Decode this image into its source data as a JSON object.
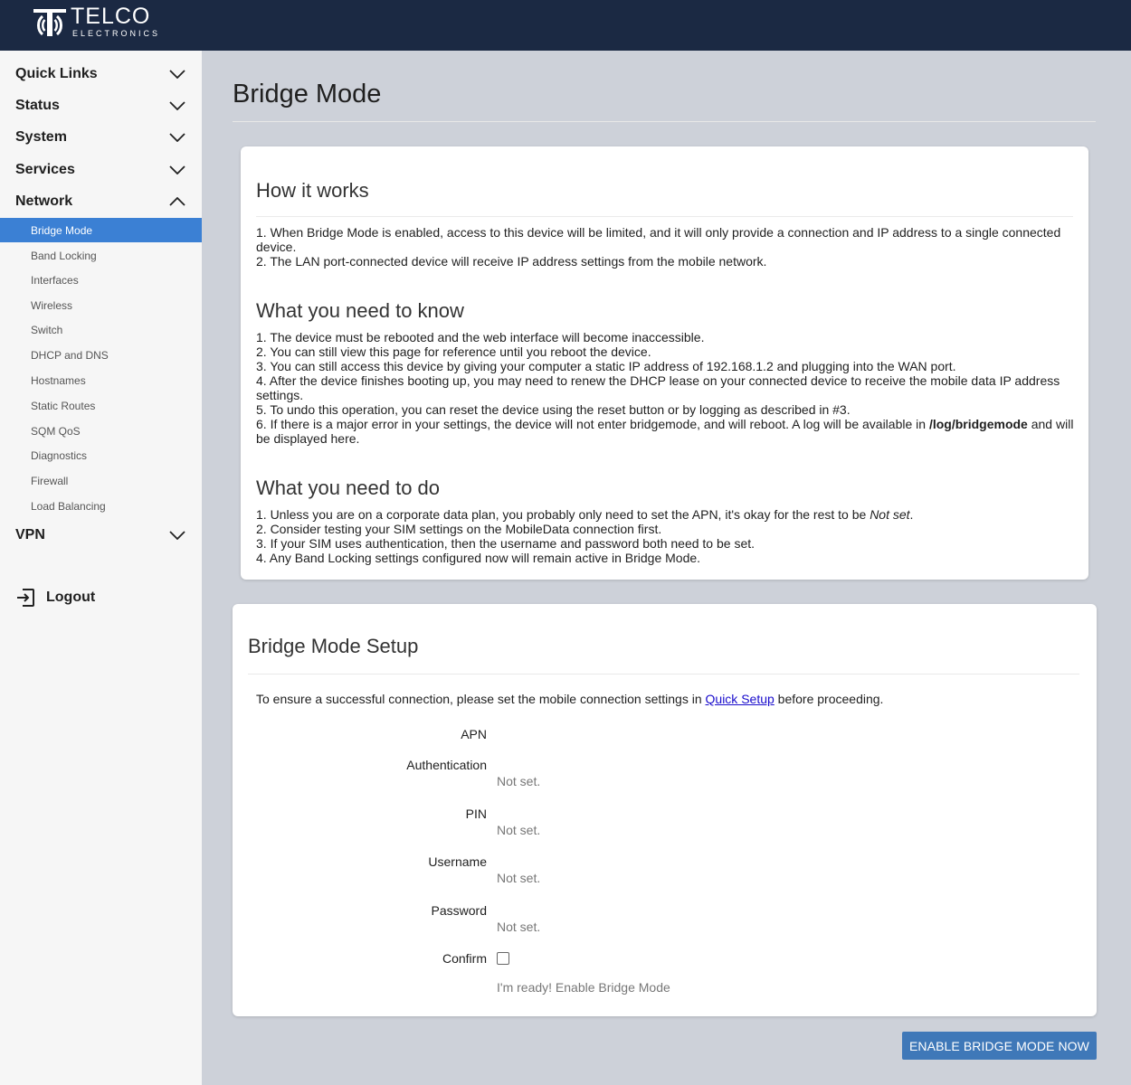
{
  "brand": {
    "name": "TELCO",
    "tagline": "ELECTRONICS"
  },
  "sidebar": {
    "sections": [
      {
        "label": "Quick Links",
        "expanded": false
      },
      {
        "label": "Status",
        "expanded": false
      },
      {
        "label": "System",
        "expanded": false
      },
      {
        "label": "Services",
        "expanded": false
      },
      {
        "label": "Network",
        "expanded": true
      }
    ],
    "network_items": [
      {
        "label": "Bridge Mode",
        "active": true
      },
      {
        "label": "Band Locking"
      },
      {
        "label": "Interfaces"
      },
      {
        "label": "Wireless"
      },
      {
        "label": "Switch"
      },
      {
        "label": "DHCP and DNS"
      },
      {
        "label": "Hostnames"
      },
      {
        "label": "Static Routes"
      },
      {
        "label": "SQM QoS"
      },
      {
        "label": "Diagnostics"
      },
      {
        "label": "Firewall"
      },
      {
        "label": "Load Balancing"
      }
    ],
    "vpn": {
      "label": "VPN",
      "expanded": false
    },
    "logout": "Logout"
  },
  "page": {
    "title": "Bridge Mode"
  },
  "info": {
    "how": {
      "heading": "How it works",
      "lines": [
        "1. When Bridge Mode is enabled, access to this device will be limited, and it will only provide a connection and IP address to a single connected device.",
        "2. The LAN port-connected device will receive IP address settings from the mobile network."
      ]
    },
    "know": {
      "heading": "What you need to know",
      "lines": [
        "1. The device must be rebooted and the web interface will become inaccessible.",
        "2. You can still view this page for reference until you reboot the device.",
        "3. You can still access this device by giving your computer a static IP address of 192.168.1.2 and plugging into the WAN port.",
        "4. After the device finishes booting up, you may need to renew the DHCP lease on your connected device to receive the mobile data IP address settings.",
        "5. To undo this operation, you can reset the device using the reset button or by logging as described in #3."
      ],
      "line6_pre": "6. If there is a major error in your settings, the device will not enter bridgemode, and will reboot. A log will be available in ",
      "line6_bold": "/log/bridgemode",
      "line6_post": " and will be displayed here."
    },
    "do": {
      "heading": "What you need to do",
      "line1_pre": "1. Unless you are on a corporate data plan, you probably only need to set the APN, it's okay for the rest to be ",
      "line1_em": "Not set",
      "line1_post": ".",
      "lines": [
        "2. Consider testing your SIM settings on the MobileData connection first.",
        "3. If your SIM uses authentication, then the username and password both need to be set.",
        "4. Any Band Locking settings configured now will remain active in Bridge Mode."
      ]
    }
  },
  "setup": {
    "heading": "Bridge Mode Setup",
    "intro_pre": "To ensure a successful connection, please set the mobile connection settings in ",
    "intro_link": "Quick Setup",
    "intro_post": " before proceeding.",
    "fields": [
      {
        "label": "APN",
        "value": ""
      },
      {
        "label": "Authentication",
        "value": "Not set."
      },
      {
        "label": "PIN",
        "value": "Not set."
      },
      {
        "label": "Username",
        "value": "Not set."
      },
      {
        "label": "Password",
        "value": "Not set."
      }
    ],
    "confirm": {
      "label": "Confirm",
      "checked": false,
      "hint": "I'm ready! Enable Bridge Mode"
    },
    "button": "ENABLE BRIDGE MODE NOW"
  }
}
